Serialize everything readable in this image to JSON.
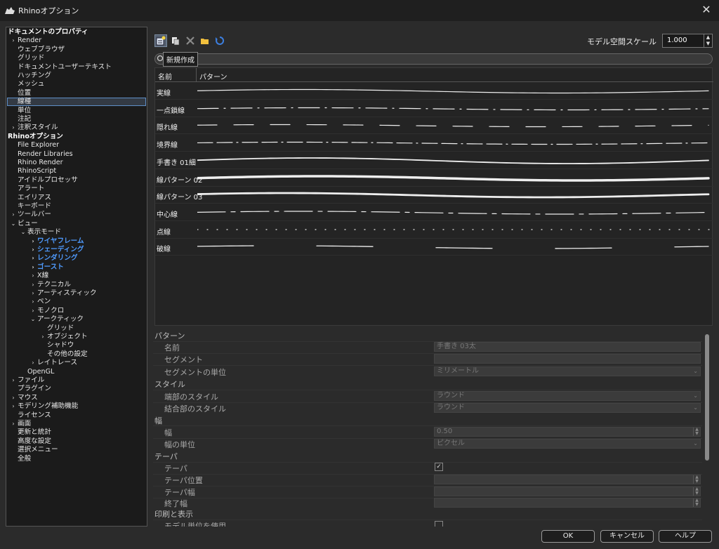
{
  "window": {
    "title": "Rhinoオプション",
    "close_label": "✕"
  },
  "tree": [
    {
      "label": "ドキュメントのプロパティ",
      "level": 0,
      "arrow": "",
      "style": "bold"
    },
    {
      "label": "Render",
      "level": 1,
      "arrow": "›",
      "style": ""
    },
    {
      "label": "ウェブブラウザ",
      "level": 1,
      "arrow": "",
      "style": ""
    },
    {
      "label": "グリッド",
      "level": 1,
      "arrow": "",
      "style": ""
    },
    {
      "label": "ドキュメントユーザーテキスト",
      "level": 1,
      "arrow": "",
      "style": ""
    },
    {
      "label": "ハッチング",
      "level": 1,
      "arrow": "",
      "style": ""
    },
    {
      "label": "メッシュ",
      "level": 1,
      "arrow": "",
      "style": ""
    },
    {
      "label": "位置",
      "level": 1,
      "arrow": "",
      "style": ""
    },
    {
      "label": "線種",
      "level": 1,
      "arrow": "",
      "style": "selected"
    },
    {
      "label": "単位",
      "level": 1,
      "arrow": "",
      "style": ""
    },
    {
      "label": "注記",
      "level": 1,
      "arrow": "",
      "style": ""
    },
    {
      "label": "注釈スタイル",
      "level": 1,
      "arrow": "›",
      "style": ""
    },
    {
      "label": "Rhinoオプション",
      "level": 0,
      "arrow": "",
      "style": "bold"
    },
    {
      "label": "File Explorer",
      "level": 1,
      "arrow": "",
      "style": ""
    },
    {
      "label": "Render Libraries",
      "level": 1,
      "arrow": "",
      "style": ""
    },
    {
      "label": "Rhino Render",
      "level": 1,
      "arrow": "",
      "style": ""
    },
    {
      "label": "RhinoScript",
      "level": 1,
      "arrow": "",
      "style": ""
    },
    {
      "label": "アイドルプロセッサ",
      "level": 1,
      "arrow": "",
      "style": ""
    },
    {
      "label": "アラート",
      "level": 1,
      "arrow": "",
      "style": ""
    },
    {
      "label": "エイリアス",
      "level": 1,
      "arrow": "",
      "style": ""
    },
    {
      "label": "キーボード",
      "level": 1,
      "arrow": "",
      "style": ""
    },
    {
      "label": "ツールバー",
      "level": 1,
      "arrow": "›",
      "style": ""
    },
    {
      "label": "ビュー",
      "level": 1,
      "arrow": "⌄",
      "style": ""
    },
    {
      "label": "表示モード",
      "level": 2,
      "arrow": "⌄",
      "style": ""
    },
    {
      "label": "ワイヤフレーム",
      "level": 3,
      "arrow": "›",
      "style": "blue"
    },
    {
      "label": "シェーディング",
      "level": 3,
      "arrow": "›",
      "style": "blue"
    },
    {
      "label": "レンダリング",
      "level": 3,
      "arrow": "›",
      "style": "blue"
    },
    {
      "label": "ゴースト",
      "level": 3,
      "arrow": "›",
      "style": "blue"
    },
    {
      "label": "X線",
      "level": 3,
      "arrow": "›",
      "style": ""
    },
    {
      "label": "テクニカル",
      "level": 3,
      "arrow": "›",
      "style": ""
    },
    {
      "label": "アーティスティック",
      "level": 3,
      "arrow": "›",
      "style": ""
    },
    {
      "label": "ペン",
      "level": 3,
      "arrow": "›",
      "style": ""
    },
    {
      "label": "モノクロ",
      "level": 3,
      "arrow": "›",
      "style": ""
    },
    {
      "label": "アークティック",
      "level": 3,
      "arrow": "⌄",
      "style": ""
    },
    {
      "label": "グリッド",
      "level": 4,
      "arrow": "",
      "style": ""
    },
    {
      "label": "オブジェクト",
      "level": 4,
      "arrow": "›",
      "style": ""
    },
    {
      "label": "シャドウ",
      "level": 4,
      "arrow": "",
      "style": ""
    },
    {
      "label": "その他の設定",
      "level": 4,
      "arrow": "",
      "style": ""
    },
    {
      "label": "レイトレース",
      "level": 3,
      "arrow": "›",
      "style": ""
    },
    {
      "label": "OpenGL",
      "level": 2,
      "arrow": "",
      "style": ""
    },
    {
      "label": "ファイル",
      "level": 1,
      "arrow": "›",
      "style": ""
    },
    {
      "label": "プラグイン",
      "level": 1,
      "arrow": "",
      "style": ""
    },
    {
      "label": "マウス",
      "level": 1,
      "arrow": "›",
      "style": ""
    },
    {
      "label": "モデリング補助機能",
      "level": 1,
      "arrow": "›",
      "style": ""
    },
    {
      "label": "ライセンス",
      "level": 1,
      "arrow": "",
      "style": ""
    },
    {
      "label": "画面",
      "level": 1,
      "arrow": "›",
      "style": ""
    },
    {
      "label": "更新と統計",
      "level": 1,
      "arrow": "",
      "style": ""
    },
    {
      "label": "高度な設定",
      "level": 1,
      "arrow": "",
      "style": ""
    },
    {
      "label": "選択メニュー",
      "level": 1,
      "arrow": "",
      "style": ""
    },
    {
      "label": "全般",
      "level": 1,
      "arrow": "",
      "style": ""
    }
  ],
  "toolbar": {
    "tooltip": "新規作成",
    "scale_label": "モデル空間スケール",
    "scale_value": "1.000"
  },
  "list": {
    "col_name": "名前",
    "col_pattern": "パターン",
    "rows": [
      {
        "name": "実線",
        "pattern": "solid"
      },
      {
        "name": "一点鎖線",
        "pattern": "dashdot"
      },
      {
        "name": "隠れ線",
        "pattern": "hidden"
      },
      {
        "name": "境界線",
        "pattern": "border"
      },
      {
        "name": "手書き 01細",
        "pattern": "hand-thin"
      },
      {
        "name": "線パターン 02",
        "pattern": "thick"
      },
      {
        "name": "線パターン 03",
        "pattern": "taper"
      },
      {
        "name": "中心線",
        "pattern": "center"
      },
      {
        "name": "点線",
        "pattern": "dots"
      },
      {
        "name": "破線",
        "pattern": "dashed"
      }
    ]
  },
  "props": {
    "pattern_section": "パターン",
    "name_label": "名前",
    "name_value": "手書き 03太",
    "segment_label": "セグメント",
    "segment_unit_label": "セグメントの単位",
    "segment_unit_value": "ミリメートル",
    "style_section": "スタイル",
    "cap_label": "端部のスタイル",
    "cap_value": "ラウンド",
    "join_label": "結合部のスタイル",
    "join_value": "ラウンド",
    "width_section": "幅",
    "width_label": "幅",
    "width_value": "0.50",
    "width_unit_label": "幅の単位",
    "width_unit_value": "ピクセル",
    "taper_section": "テーパ",
    "taper_label": "テーパ",
    "taper_pos_label": "テーパ位置",
    "taper_width_label": "テーパ幅",
    "end_width_label": "終了幅",
    "print_section": "印刷と表示",
    "model_units_label": "モデル単位を使用"
  },
  "buttons": {
    "ok": "OK",
    "cancel": "キャンセル",
    "help": "ヘルプ"
  }
}
